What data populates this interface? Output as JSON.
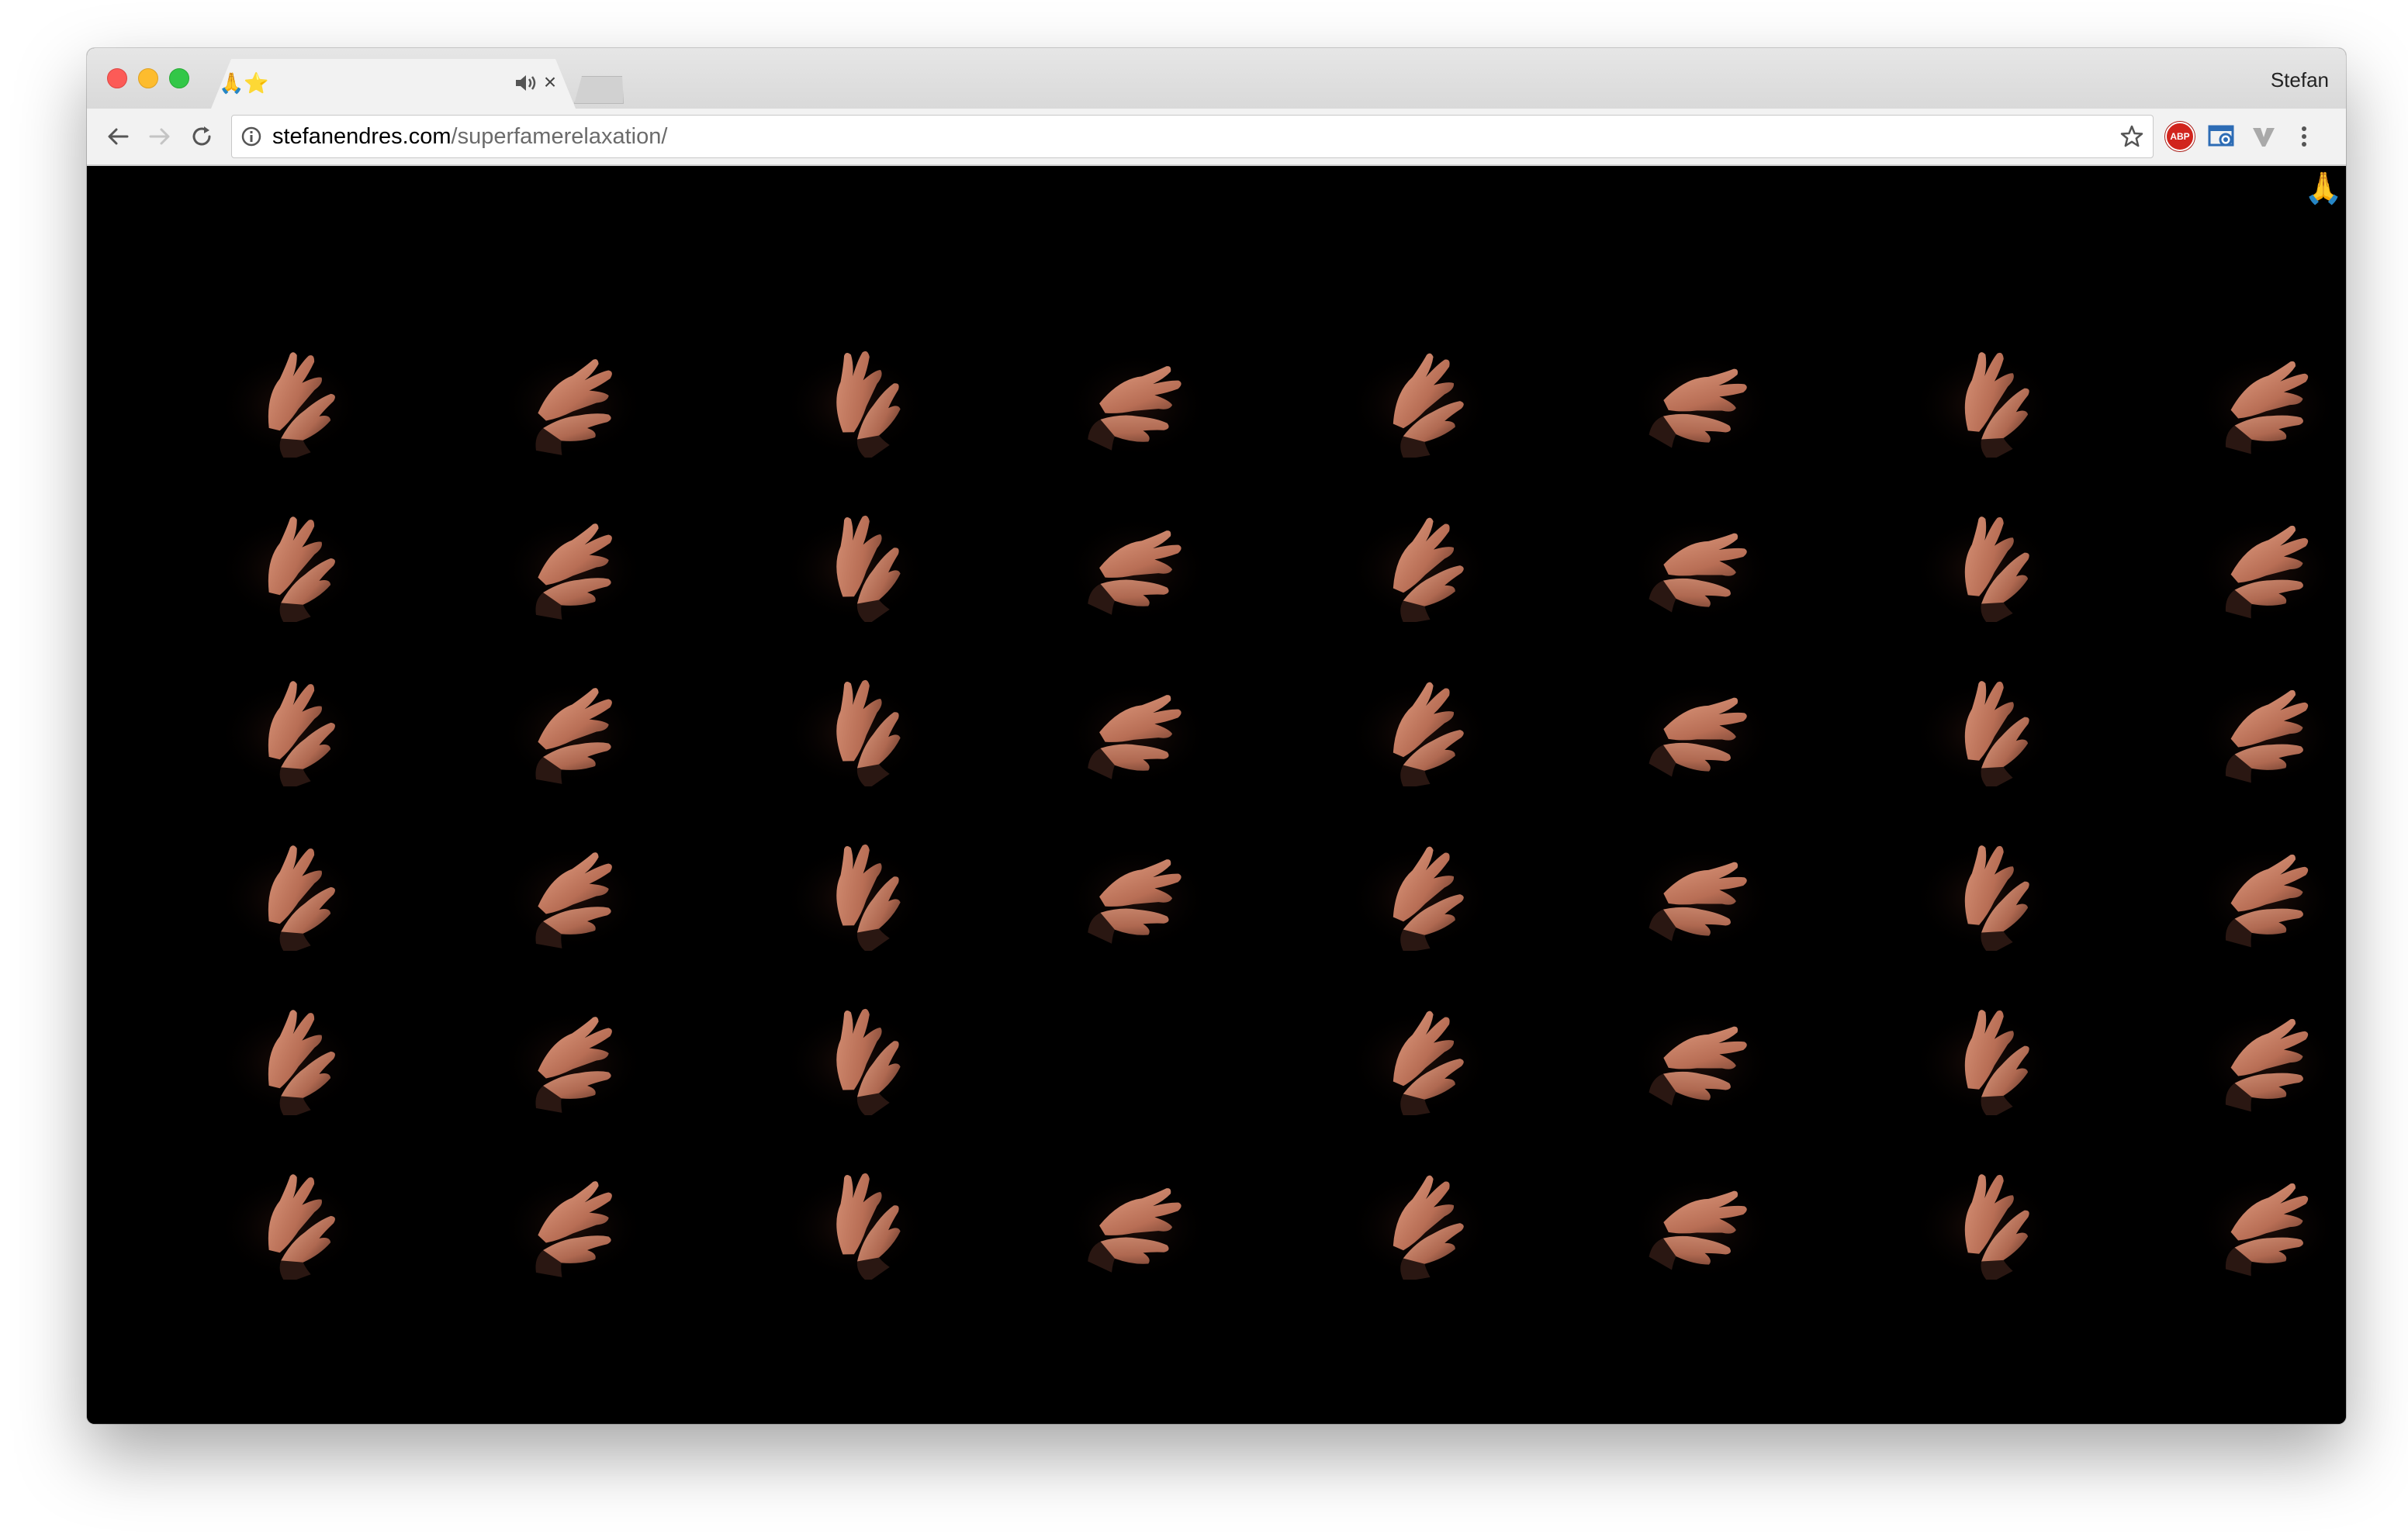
{
  "browser": {
    "tab": {
      "title": "🙏⭐",
      "audio_icon": "speaker-icon",
      "close_label": "×"
    },
    "profile_name": "Stefan",
    "address_bar": {
      "domain": "stefanendres.com",
      "path": "/superfamerelaxation/"
    },
    "extensions": [
      "adblock-plus-icon",
      "screenshot-extension-icon",
      "vimium-icon",
      "menu-icon"
    ],
    "abp_label": "ABP"
  },
  "page": {
    "corner_emoji": "🙏",
    "background": "#000000",
    "grid": {
      "columns": 8,
      "rows": 6,
      "cells": [
        [
          "clap",
          "clap",
          "clap",
          "clap",
          "clap",
          "clap",
          "clap",
          "clap"
        ],
        [
          "clap",
          "clap",
          "clap",
          "clap",
          "clap",
          "clap",
          "clap",
          "clap"
        ],
        [
          "clap",
          "clap",
          "clap",
          "clap",
          "clap",
          "clap",
          "clap",
          "clap"
        ],
        [
          "clap",
          "clap",
          "clap",
          "clap",
          "clap",
          "clap",
          "clap",
          "clap"
        ],
        [
          "clap",
          "clap",
          "clap",
          "empty",
          "clap",
          "clap",
          "clap",
          "clap"
        ],
        [
          "clap",
          "clap",
          "clap",
          "clap",
          "clap",
          "clap",
          "clap",
          "clap"
        ]
      ]
    }
  }
}
